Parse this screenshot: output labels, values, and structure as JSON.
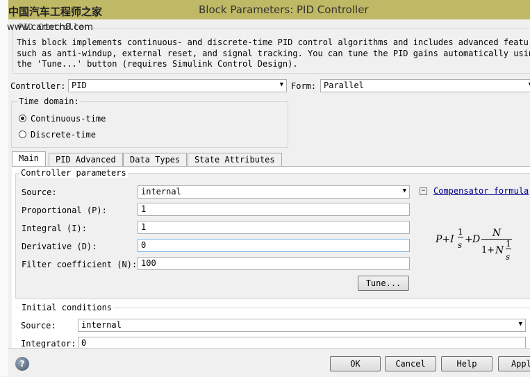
{
  "window": {
    "title": "Block Parameters: PID Controller"
  },
  "watermark": {
    "line1": "中国汽车工程师之家",
    "line2": "www.cartech8.com"
  },
  "group_label": "PID Controller",
  "description": [
    "This block implements continuous- and discrete-time PID control algorithms and includes advanced features",
    "such as anti-windup, external reset, and signal tracking. You can tune the PID gains automatically using",
    "the 'Tune...' button (requires Simulink Control Design)."
  ],
  "controller": {
    "label": "Controller:",
    "value": "PID"
  },
  "form": {
    "label": "Form:",
    "value": "Parallel"
  },
  "time_domain": {
    "label": "Time domain:",
    "options": [
      {
        "label": "Continuous-time",
        "selected": true
      },
      {
        "label": "Discrete-time",
        "selected": false
      }
    ]
  },
  "tabs": [
    "Main",
    "PID Advanced",
    "Data Types",
    "State Attributes"
  ],
  "controller_params": {
    "label": "Controller parameters",
    "source": {
      "label": "Source:",
      "value": "internal"
    },
    "fields": [
      {
        "label": "Proportional (P):",
        "value": "1"
      },
      {
        "label": "Integral (I):",
        "value": "1"
      },
      {
        "label": "Derivative (D):",
        "value": "0"
      },
      {
        "label": "Filter coefficient (N):",
        "value": "100"
      }
    ],
    "tune": "Tune...",
    "compensator_link": "Compensator formula",
    "formula": {
      "p": "P",
      "plus": "+",
      "i": "I",
      "one": "1",
      "s": "s",
      "d": "D",
      "n": "N",
      "onep": "1+"
    }
  },
  "initial": {
    "label": "Initial conditions",
    "source": {
      "label": "Source:",
      "value": "internal"
    },
    "integrator": {
      "label": "Integrator:",
      "value": "0"
    }
  },
  "buttons": {
    "ok": "OK",
    "cancel": "Cancel",
    "help": "Help",
    "apply": "Apply"
  }
}
